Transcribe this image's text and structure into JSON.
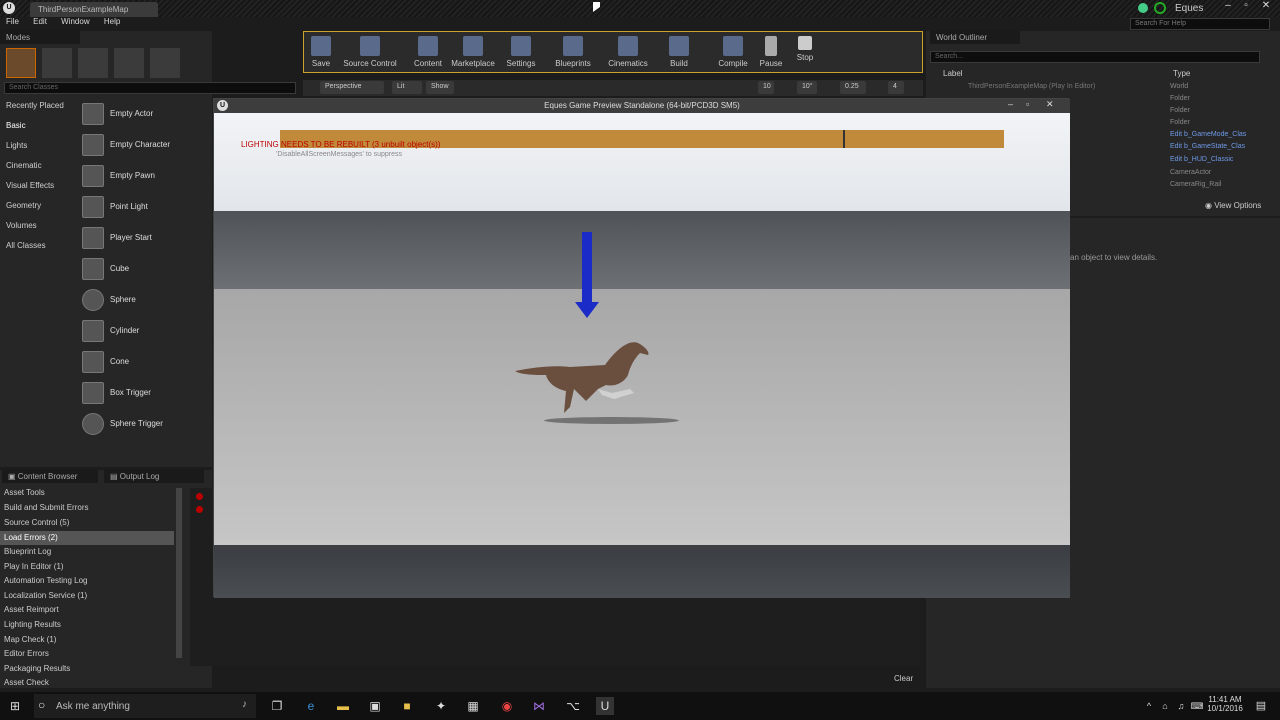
{
  "app": {
    "doc_tab": "ThirdPersonExampleMap",
    "user": "Eques",
    "help_search": "Search For Help"
  },
  "menu": [
    "File",
    "Edit",
    "Window",
    "Help"
  ],
  "modes": {
    "title": "Modes",
    "search_placeholder": "Search Classes",
    "categories": [
      "Recently Placed",
      "Basic",
      "Lights",
      "Cinematic",
      "Visual Effects",
      "Geometry",
      "Volumes",
      "All Classes"
    ],
    "items": [
      "Empty Actor",
      "Empty Character",
      "Empty Pawn",
      "Point Light",
      "Player Start",
      "Cube",
      "Sphere",
      "Cylinder",
      "Cone",
      "Box Trigger",
      "Sphere Trigger"
    ]
  },
  "toolbar": [
    "Save",
    "Source Control",
    "Content",
    "Marketplace",
    "Settings",
    "Blueprints",
    "Cinematics",
    "Build",
    "Compile",
    "Pause",
    "Stop"
  ],
  "viewport": {
    "perspective": "Perspective",
    "lit": "Lit",
    "show": "Show",
    "grid": "10",
    "angle": "10°",
    "scale": "0.25",
    "cam": "4"
  },
  "game": {
    "title": "Eques Game Preview Standalone (64-bit/PCD3D SM5)",
    "warning": "LIGHTING NEEDS TO BE REBUILT (3 unbuilt object(s))",
    "hint": "'DisableAllScreenMessages' to suppress"
  },
  "outliner": {
    "title": "World Outliner",
    "search_placeholder": "Search...",
    "col_label": "Label",
    "col_type": "Type",
    "root": "ThirdPersonExampleMap (Play In Editor)",
    "types": [
      "World",
      "Folder",
      "Folder",
      "Folder",
      "Edit b_GameMode_Clas",
      "Edit b_GameState_Clas",
      "Edit b_HUD_Classic",
      "CameraActor",
      "CameraRig_Rail"
    ],
    "view_options": "View Options"
  },
  "details": {
    "hint": "an object to view details."
  },
  "bottom": {
    "tab1": "Content Browser",
    "tab2": "Output Log",
    "clear": "Clear",
    "log_items": [
      "Asset Tools",
      "Build and Submit Errors",
      "Source Control (5)",
      "Load Errors (2)",
      "Blueprint Log",
      "Play In Editor (1)",
      "Automation Testing Log",
      "Localization Service (1)",
      "Asset Reimport",
      "Lighting Results",
      "Map Check (1)",
      "Editor Errors",
      "Packaging Results",
      "Asset Check"
    ]
  },
  "taskbar": {
    "search_placeholder": "Ask me anything",
    "time": "11:41 AM",
    "date": "10/1/2016"
  },
  "colors": {
    "accent": "#c08a3a",
    "arrow": "#1a2bc8",
    "warning": "#b00000",
    "link": "#6f9ae8"
  }
}
